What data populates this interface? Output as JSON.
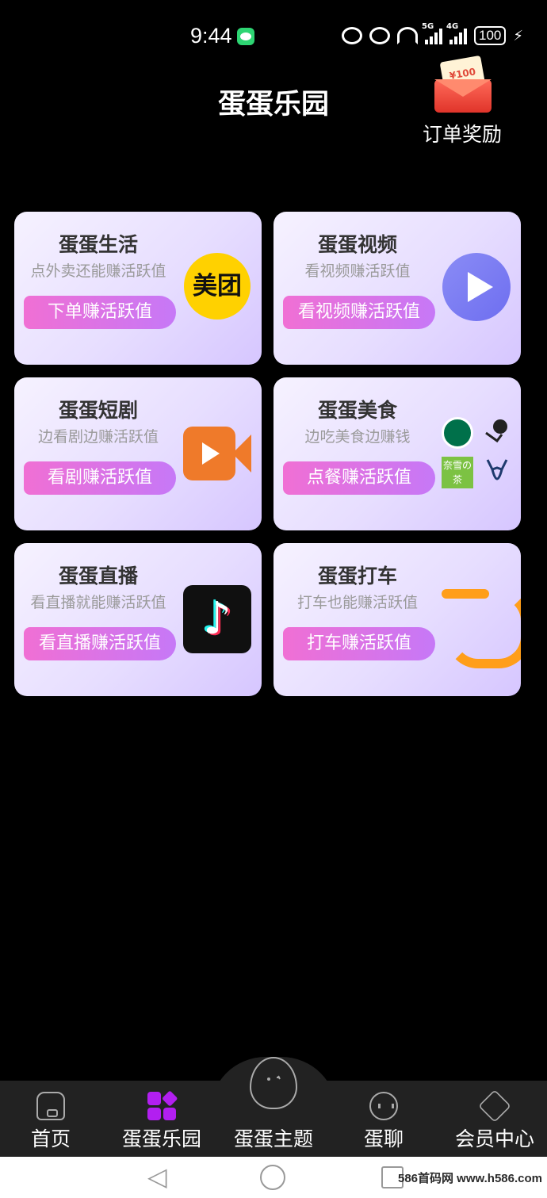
{
  "status_bar": {
    "time": "9:44",
    "network_1": "5G",
    "network_2": "4G",
    "battery": "100"
  },
  "header": {
    "title": "蛋蛋乐园",
    "reward_label": "订单奖励",
    "reward_badge": "100"
  },
  "cards": [
    {
      "title": "蛋蛋生活",
      "subtitle": "点外卖还能赚活跃值",
      "button": "下单赚活跃值",
      "logo_text": "美团",
      "icon": "meituan-logo"
    },
    {
      "title": "蛋蛋视频",
      "subtitle": "看视频赚活跃值",
      "button": "看视频赚活跃值",
      "icon": "play-icon"
    },
    {
      "title": "蛋蛋短剧",
      "subtitle": "边看剧边赚活跃值",
      "button": "看剧赚活跃值",
      "icon": "video-camera-icon"
    },
    {
      "title": "蛋蛋美食",
      "subtitle": "边吃美食边赚钱",
      "button": "点餐赚活跃值",
      "logo_text": "奈雪の茶",
      "icon": "food-brands-logo"
    },
    {
      "title": "蛋蛋直播",
      "subtitle": "看直播就能赚活跃值",
      "button": "看直播赚活跃值",
      "logo_text": "♪",
      "icon": "tiktok-logo"
    },
    {
      "title": "蛋蛋打车",
      "subtitle": "打车也能赚活跃值",
      "button": "打车赚活跃值",
      "icon": "didi-logo"
    }
  ],
  "nav": [
    {
      "label": "首页",
      "icon": "home-icon"
    },
    {
      "label": "蛋蛋乐园",
      "icon": "park-icon",
      "active": true
    },
    {
      "label": "蛋蛋主题",
      "icon": "egg-icon"
    },
    {
      "label": "蛋聊",
      "icon": "chat-icon"
    },
    {
      "label": "会员中心",
      "icon": "vip-icon"
    }
  ],
  "watermark": "586首码网 www.h586.com",
  "colors": {
    "background": "#000000",
    "card_gradient_end": "#d6c6ff",
    "button_start": "#f06fd4",
    "button_end": "#c678f7",
    "active_nav": "#b21ff0"
  }
}
